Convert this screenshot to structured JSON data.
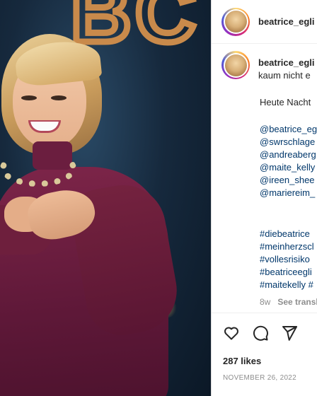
{
  "post": {
    "username": "beatrice_egli",
    "caption_prefix": "kaum nicht e",
    "caption_line2": "Heute Nacht",
    "mentions": [
      "@beatrice_eg",
      "@swrschlage",
      "@andreaberg",
      "@maite_kelly",
      "@ireen_shee",
      "@mariereim_"
    ],
    "hashtags": [
      "#diebeatrice",
      "#meinherzscl",
      "#vollesrisiko",
      "#beatriceegli",
      "#maitekelly #"
    ],
    "time_ago": "8w",
    "see_translation": "See transl",
    "likes": "287 likes",
    "date": "NOVEMBER 26, 2022"
  },
  "icons": {
    "like": "heart-icon",
    "comment": "comment-icon",
    "share": "send-icon"
  },
  "colors": {
    "text": "#262626",
    "link": "#00376b",
    "muted": "#8e8e8e",
    "dress": "#6b1e3f",
    "stage_sign": "#c98a4b"
  }
}
